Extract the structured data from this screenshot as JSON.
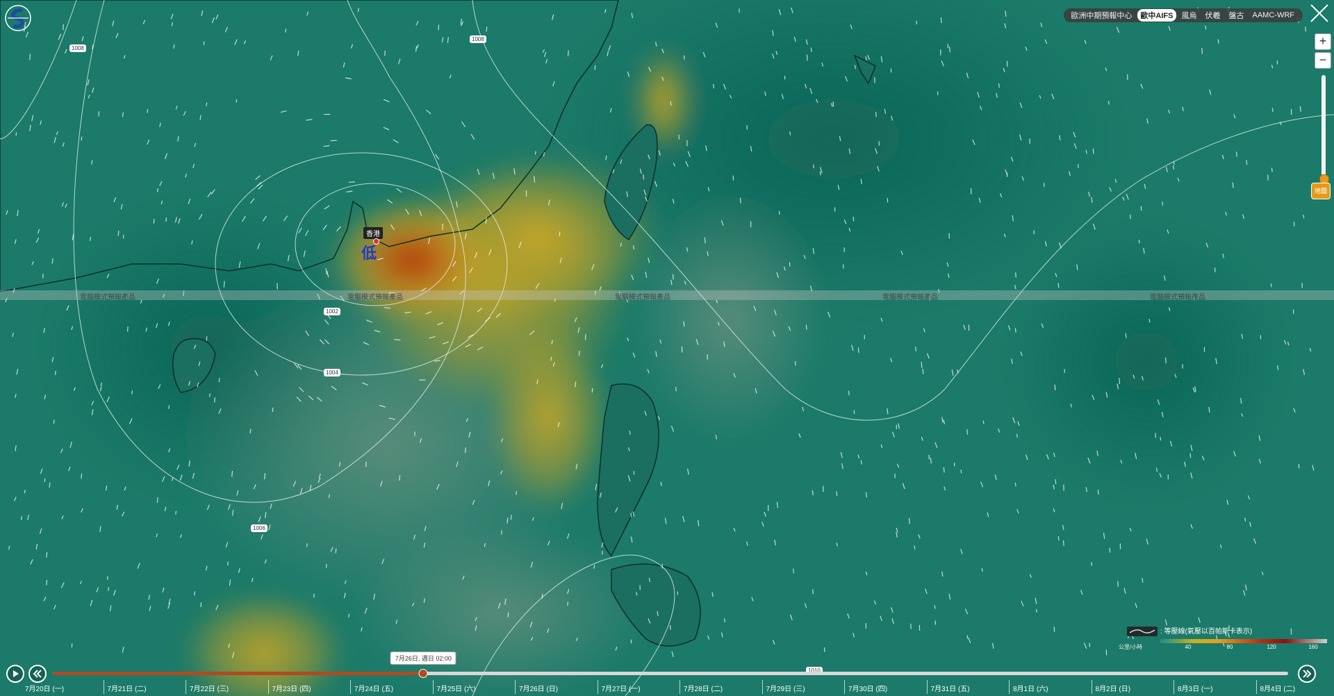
{
  "watermark": "電腦模式預報產品",
  "models": [
    {
      "label": "歐洲中期預報中心",
      "active": false
    },
    {
      "label": "歐中AIFS",
      "active": true
    },
    {
      "label": "風烏",
      "active": false
    },
    {
      "label": "伏羲",
      "active": false
    },
    {
      "label": "盤古",
      "active": false
    },
    {
      "label": "AAMC-WRF",
      "active": false
    }
  ],
  "zoom": {
    "in": "+",
    "out": "−"
  },
  "layer_button": "地圖",
  "location_label": "香港",
  "pressure_system_char": "低",
  "isobar_labels": [
    "1008",
    "1008",
    "1002",
    "1004",
    "1006",
    "1010"
  ],
  "legend": {
    "title": ": 等壓線(氣壓以百帕斯卡表示)",
    "unit": "公里/小時",
    "ticks": [
      "40",
      "80",
      "120",
      "160"
    ]
  },
  "timeline": {
    "tooltip": "7月26日, 週日 02:00",
    "progress": 0.3,
    "dates": [
      "7月20日 (一)",
      "7月21日 (二)",
      "7月22日 (三)",
      "7月23日 (四)",
      "7月24日 (五)",
      "7月25日 (六)",
      "7月26日 (日)",
      "7月27日 (一)",
      "7月28日 (二)",
      "7月29日 (三)",
      "7月30日 (四)",
      "7月31日 (五)",
      "8月1日 (六)",
      "8月2日 (日)",
      "8月3日 (一)",
      "8月4日 (二)"
    ]
  },
  "colors": {
    "sea": "#1a7a68",
    "wind_high": "#b03a10",
    "wind_mid": "#d09a18",
    "accent": "#e69a1a"
  }
}
